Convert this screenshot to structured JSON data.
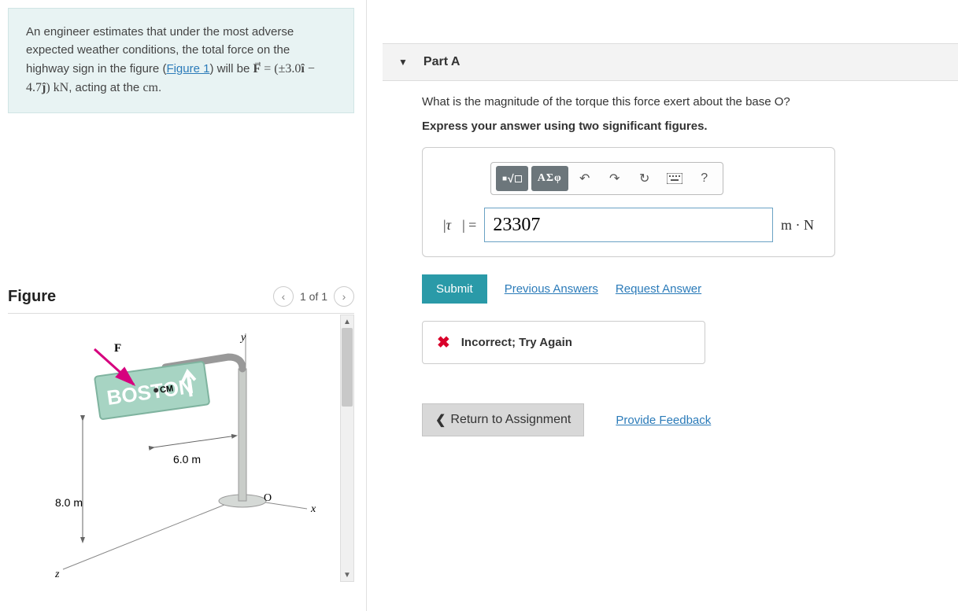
{
  "problem": {
    "intro_a": "An engineer estimates that under the most adverse expected weather conditions, the total force on the highway sign in the figure (",
    "figure_link": "Figure 1",
    "intro_b": ") will be ",
    "formula_lhs": "F",
    "formula_eq": " = (±3.0",
    "formula_i": "î",
    "formula_mid": " − 4.7",
    "formula_j": "ĵ",
    "formula_rhs": ") kN",
    "intro_c": ", acting at the ",
    "cm": "cm",
    "intro_d": "."
  },
  "figure": {
    "title": "Figure",
    "pager": "1 of 1",
    "labels": {
      "y": "y",
      "x": "x",
      "z": "z",
      "F": "F",
      "CM": "CM",
      "O": "O",
      "sign_text": "BOSTON",
      "dim_h": "6.0 m",
      "dim_v": "8.0 m"
    }
  },
  "part": {
    "label": "Part A",
    "question": "What is the magnitude of the torque this force exert about the base O?",
    "instruction": "Express your answer using two significant figures."
  },
  "toolbar": {
    "templates": "■√□",
    "greek": "ΑΣφ",
    "undo": "↶",
    "redo": "↷",
    "reset": "↻",
    "keyboard": "⌨",
    "help": "?"
  },
  "answer": {
    "lhs": "|τ⃗| =",
    "value": "23307",
    "units": "m · N"
  },
  "actions": {
    "submit": "Submit",
    "previous": "Previous Answers",
    "request": "Request Answer"
  },
  "feedback": {
    "text": "Incorrect; Try Again"
  },
  "bottom": {
    "return": "Return to Assignment",
    "provide": "Provide Feedback"
  }
}
